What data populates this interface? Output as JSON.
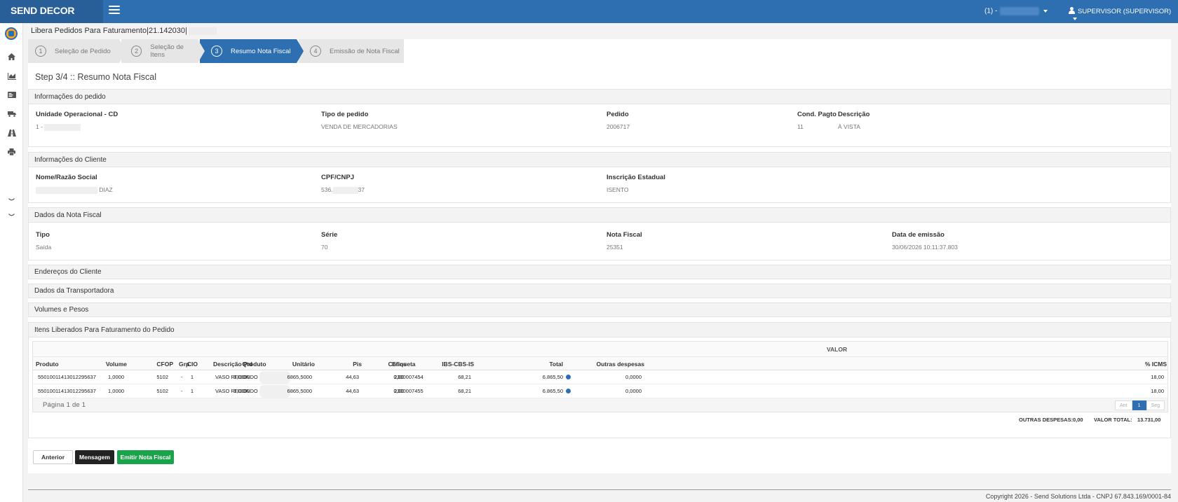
{
  "topbar": {
    "brand": "SEND DECOR",
    "company_prefix": "(1) -",
    "user": "SUPERVISOR (SUPERVISOR)"
  },
  "breadcrumb": "Libera Pedidos Para Faturamento|21.142030|",
  "wizard": {
    "steps": [
      {
        "num": "1",
        "label": "Seleção de Pedido"
      },
      {
        "num": "2",
        "label": "Seleção de Itens"
      },
      {
        "num": "3",
        "label": "Resumo Nota Fiscal"
      },
      {
        "num": "4",
        "label": "Emissão de Nota Fiscal"
      }
    ],
    "active_index": 2,
    "title": "Step 3/4 :: Resumo Nota Fiscal"
  },
  "pedido": {
    "header": "Informações do pedido",
    "unidade_label": "Unidade Operacional - CD",
    "unidade_value": "1 -",
    "tipo_label": "Tipo de pedido",
    "tipo_value": "VENDA DE MERCADORIAS",
    "pedido_label": "Pedido",
    "pedido_value": "2006717",
    "cond_label": "Cond. Pagto",
    "cond_value": "11",
    "descricao_label": "Descrição",
    "descricao_value": "À VISTA"
  },
  "cliente": {
    "header": "Informações do Cliente",
    "nome_label": "Nome/Razão Social",
    "nome_value": "DIAZ",
    "cpf_label": "CPF/CNPJ",
    "cpf_prefix": "536.",
    "cpf_suffix": "37",
    "ie_label": "Inscrição Estadual",
    "ie_value": "ISENTO"
  },
  "nota": {
    "header": "Dados da Nota Fiscal",
    "tipo_label": "Tipo",
    "tipo_value": "Saída",
    "serie_label": "Série",
    "serie_value": "70",
    "nf_label": "Nota Fiscal",
    "nf_value": "25351",
    "data_label": "Data de emissão",
    "data_value": "30/06/2026 10:11:37.803"
  },
  "collapsed_sections": [
    "Endereços do Cliente",
    "Dados da Transportadora",
    "Volumes e Pesos"
  ],
  "itens": {
    "header": "Itens Liberados Para Faturamento do Pedido",
    "group_label": "VALOR",
    "columns": [
      "Produto",
      "Grp.",
      "Descrição Produto",
      "Etiqueta",
      "Volume",
      "CFOP",
      "CIO",
      "Qtd",
      "Unitário",
      "Pis",
      "Cofins",
      "IBS-CBS-IS",
      "Total",
      "Outras despesas",
      "% ICMS"
    ],
    "rows": [
      {
        "produto": "55010011413012295637",
        "grp": "-",
        "descricao": "VASO REDONDO",
        "etiqueta": "2300007454",
        "volume": "1,0000",
        "cfop": "5102",
        "cio": "1",
        "qtd": "1,0000",
        "unitario": "6865,5000",
        "pis": "44,63",
        "cofins": "0,00",
        "ibs": "68,21",
        "total": "6.865,50",
        "outras": "0,0000",
        "icms": "18,00"
      },
      {
        "produto": "55010011413012295637",
        "grp": "-",
        "descricao": "VASO REDONDO",
        "etiqueta": "2300007455",
        "volume": "1,0000",
        "cfop": "5102",
        "cio": "1",
        "qtd": "1,0000",
        "unitario": "6865,5000",
        "pis": "44,63",
        "cofins": "0,00",
        "ibs": "68,21",
        "total": "6.865,50",
        "outras": "0,0000",
        "icms": "18,00"
      }
    ],
    "pagination_text": "Página 1 de 1",
    "pager": {
      "prev": "Ant",
      "current": "1",
      "next": "Seg"
    },
    "outras_despesas_label": "OUTRAS DESPESAS:",
    "outras_despesas_value": "0,00",
    "valor_total_label": "VALOR TOTAL:",
    "valor_total_value": "13.731,00"
  },
  "buttons": {
    "anterior": "Anterior",
    "mensagem": "Mensagem",
    "emitir": "Emitir Nota Fiscal"
  },
  "footer": {
    "copyright": "Copyright 2026 - Send Solutions Ltda - CNPJ 67.843.169/0001-84"
  },
  "colors": {
    "primary": "#2e6fb2",
    "emit_button": "#1aa34a",
    "dark_button": "#222222"
  }
}
